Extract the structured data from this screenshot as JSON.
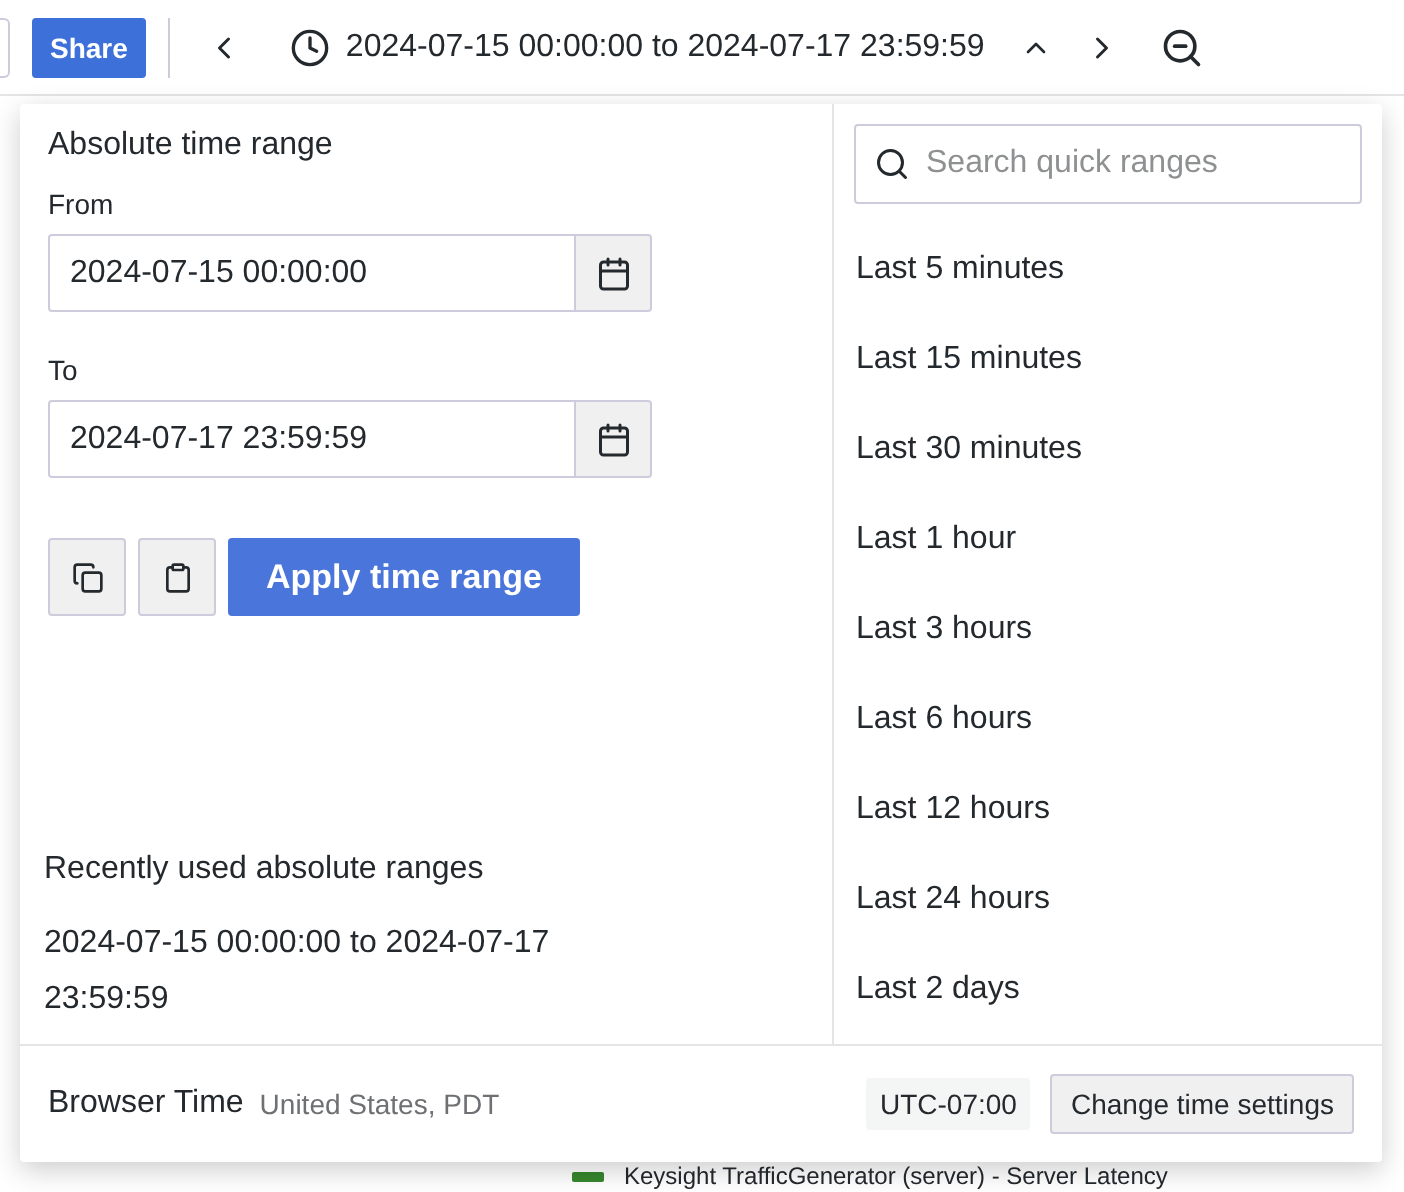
{
  "toolbar": {
    "share_button": "Share",
    "time_range": "2024-07-15 00:00:00 to 2024-07-17 23:59:59"
  },
  "time_picker": {
    "title": "Absolute time range",
    "fields": [
      {
        "label": "From",
        "value": "2024-07-15 00:00:00"
      },
      {
        "label": "To",
        "value": "2024-07-17 23:59:59"
      }
    ],
    "apply_button": "Apply time range",
    "recent_title": "Recently used absolute ranges",
    "recent_ranges": [
      "2024-07-15 00:00:00 to 2024-07-17 23:59:59"
    ],
    "search": {
      "placeholder": "Search quick ranges"
    },
    "quick_ranges": [
      "Last 5 minutes",
      "Last 15 minutes",
      "Last 30 minutes",
      "Last 1 hour",
      "Last 3 hours",
      "Last 6 hours",
      "Last 12 hours",
      "Last 24 hours",
      "Last 2 days"
    ],
    "footer": {
      "label": "Browser Time",
      "location": "United States, PDT",
      "offset": "UTC-07:00",
      "settings_button": "Change time settings"
    }
  },
  "legend": {
    "series": [
      {
        "name": "Keysight TrafficGenerator (server) - Server Latency",
        "color": "#37872d"
      }
    ]
  }
}
